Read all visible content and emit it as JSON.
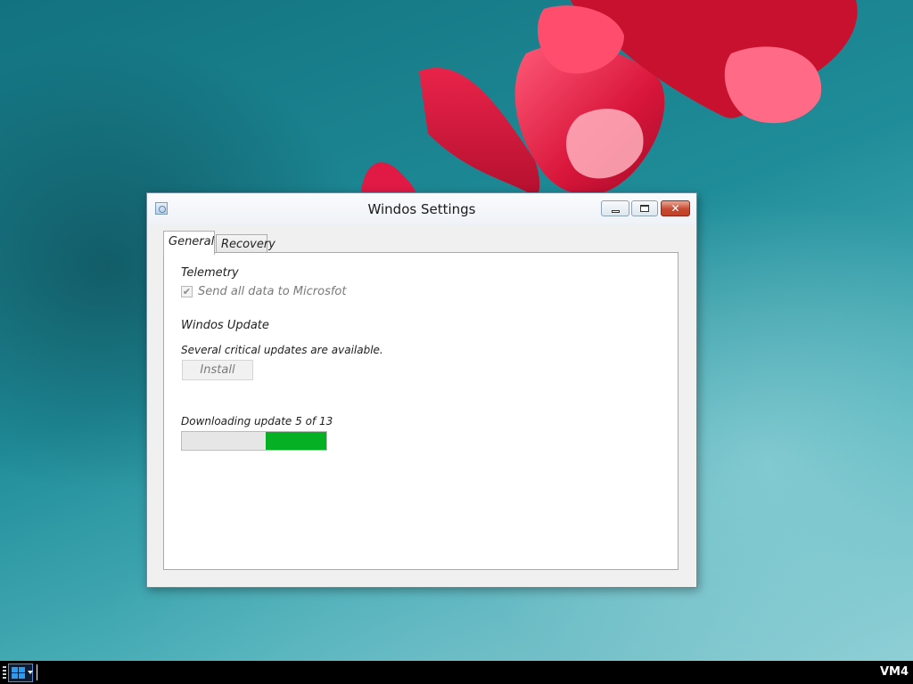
{
  "window": {
    "title": "Windos Settings",
    "close_glyph": "✕"
  },
  "tabs": [
    {
      "label": "General",
      "active": true
    },
    {
      "label": "Recovery",
      "active": false
    }
  ],
  "telemetry": {
    "heading": "Telemetry",
    "checkbox_label": "Send all data to Microsfot",
    "checked": true,
    "enabled": false
  },
  "update": {
    "heading": "Windos Update",
    "message": "Several critical updates are available.",
    "install_label": "Install",
    "install_enabled": false
  },
  "download": {
    "status": "Downloading update 5 of 13",
    "progress_segment_start": 0.58,
    "progress_segment_end": 1.0
  },
  "taskbar": {
    "vm_label": "VM4"
  },
  "colors": {
    "progress_fill": "#06b025",
    "close_button": "#c74a32",
    "start_logo": "#2c9cf0"
  }
}
